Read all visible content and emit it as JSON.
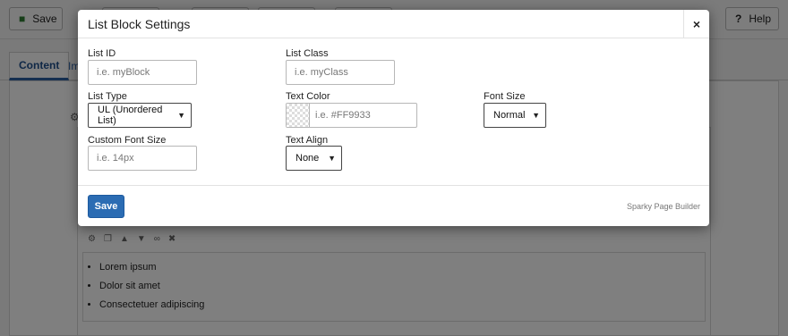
{
  "toolbar": {
    "save_label": "Save",
    "help_label": "Help",
    "save_icon": "save-icon",
    "help_icon": "question-icon"
  },
  "tabs": [
    {
      "label": "Content"
    },
    {
      "label": "Ima"
    }
  ],
  "list": {
    "items": [
      "Lorem ipsum",
      "Dolor sit amet",
      "Consectetuer adipiscing"
    ]
  },
  "modal": {
    "title": "List Block Settings",
    "close_label": "×",
    "fields": {
      "list_id": {
        "label": "List ID",
        "placeholder": "i.e. myBlock"
      },
      "list_class": {
        "label": "List Class",
        "placeholder": "i.e. myClass"
      },
      "list_type": {
        "label": "List Type",
        "value": "UL (Unordered List)"
      },
      "text_color": {
        "label": "Text Color",
        "placeholder": "i.e. #FF9933"
      },
      "font_size": {
        "label": "Font Size",
        "value": "Normal"
      },
      "custom_font_size": {
        "label": "Custom Font Size",
        "placeholder": "i.e. 14px"
      },
      "text_align": {
        "label": "Text Align",
        "value": "None"
      }
    },
    "save_label": "Save",
    "brand": "Sparky Page Builder"
  },
  "colors": {
    "primary_button": "#2b6cb3",
    "overlay": "rgba(0,0,0,0.5)",
    "tab_active": "#2a5ea0"
  }
}
